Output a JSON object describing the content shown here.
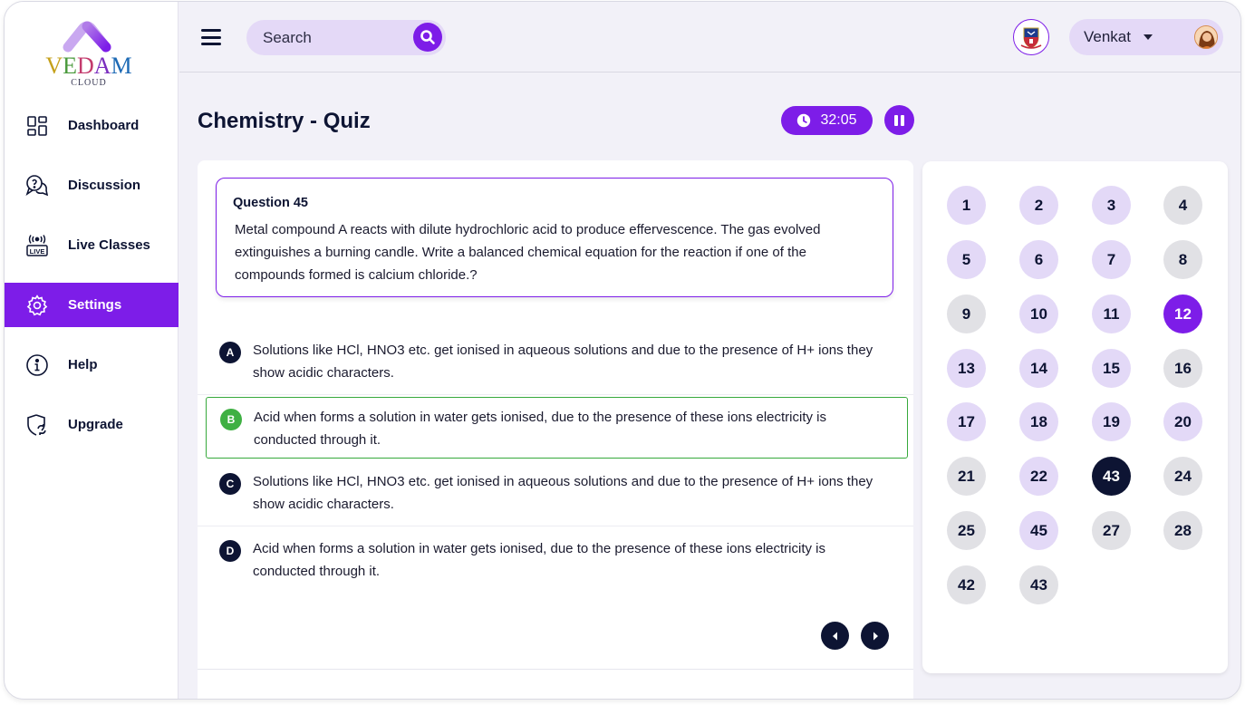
{
  "brand": {
    "name_parts": [
      "V",
      "E",
      "D",
      "A",
      "M"
    ],
    "sub": "CLOUD",
    "colors": [
      "#c5a11b",
      "#4a9a3c",
      "#c33b6d",
      "#7b2fbf",
      "#1d6ab5"
    ]
  },
  "sidebar": {
    "items": [
      {
        "label": "Dashboard",
        "icon": "dashboard-icon",
        "active": false
      },
      {
        "label": "Discussion",
        "icon": "discussion-icon",
        "active": false
      },
      {
        "label": "Live Classes",
        "icon": "live-icon",
        "active": false
      },
      {
        "label": "Settings",
        "icon": "gear-icon",
        "active": true
      },
      {
        "label": "Help",
        "icon": "info-icon",
        "active": false
      },
      {
        "label": "Upgrade",
        "icon": "upgrade-icon",
        "active": false
      }
    ]
  },
  "header": {
    "search": {
      "placeholder": "Search"
    },
    "user": {
      "name": "Venkat"
    }
  },
  "quiz": {
    "title": "Chemistry - Quiz",
    "timer": "32:05",
    "question": {
      "number_label": "Question 45",
      "text": "Metal compound A reacts with dilute hydrochloric acid to produce effervescence. The gas evolved extinguishes a burning candle. Write a balanced chemical equation for the reaction if one of the compounds formed is calcium chloride.?"
    },
    "options": [
      {
        "letter": "A",
        "text": "Solutions like HCl, HNO3 etc. get ionised in aqueous solutions and due to the presence of H+ ions they show acidic characters.",
        "selected": false
      },
      {
        "letter": "B",
        "text": "Acid when forms a solution in water gets ionised, due to the presence of these ions electricity is conducted through it.",
        "selected": true
      },
      {
        "letter": "C",
        "text": "Solutions like HCl, HNO3 etc. get ionised in aqueous solutions and due to the presence of H+ ions they show acidic characters.",
        "selected": false
      },
      {
        "letter": "D",
        "text": "Acid when forms a solution in water gets ionised, due to the presence of these ions electricity is conducted through it.",
        "selected": false
      }
    ]
  },
  "question_grid": [
    {
      "label": "1",
      "state": "lavender"
    },
    {
      "label": "2",
      "state": "lavender"
    },
    {
      "label": "3",
      "state": "lavender"
    },
    {
      "label": "4",
      "state": "gray"
    },
    {
      "label": "5",
      "state": "lavender"
    },
    {
      "label": "6",
      "state": "lavender"
    },
    {
      "label": "7",
      "state": "lavender"
    },
    {
      "label": "8",
      "state": "gray"
    },
    {
      "label": "9",
      "state": "gray"
    },
    {
      "label": "10",
      "state": "lavender"
    },
    {
      "label": "11",
      "state": "lavender"
    },
    {
      "label": "12",
      "state": "current"
    },
    {
      "label": "13",
      "state": "lavender"
    },
    {
      "label": "14",
      "state": "lavender"
    },
    {
      "label": "15",
      "state": "lavender"
    },
    {
      "label": "16",
      "state": "gray"
    },
    {
      "label": "17",
      "state": "lavender"
    },
    {
      "label": "18",
      "state": "lavender"
    },
    {
      "label": "19",
      "state": "lavender"
    },
    {
      "label": "20",
      "state": "lavender"
    },
    {
      "label": "21",
      "state": "gray"
    },
    {
      "label": "22",
      "state": "lavender"
    },
    {
      "label": "43",
      "state": "dark"
    },
    {
      "label": "24",
      "state": "gray"
    },
    {
      "label": "25",
      "state": "gray"
    },
    {
      "label": "45",
      "state": "lavender"
    },
    {
      "label": "27",
      "state": "gray"
    },
    {
      "label": "28",
      "state": "gray"
    },
    {
      "label": "42",
      "state": "gray"
    },
    {
      "label": "43",
      "state": "gray"
    }
  ],
  "colors": {
    "accent": "#7d1de8",
    "navy": "#0d1433",
    "selected_green": "#3fb043",
    "lavender": "#e3d9f7",
    "gray": "#e1e1e5"
  }
}
